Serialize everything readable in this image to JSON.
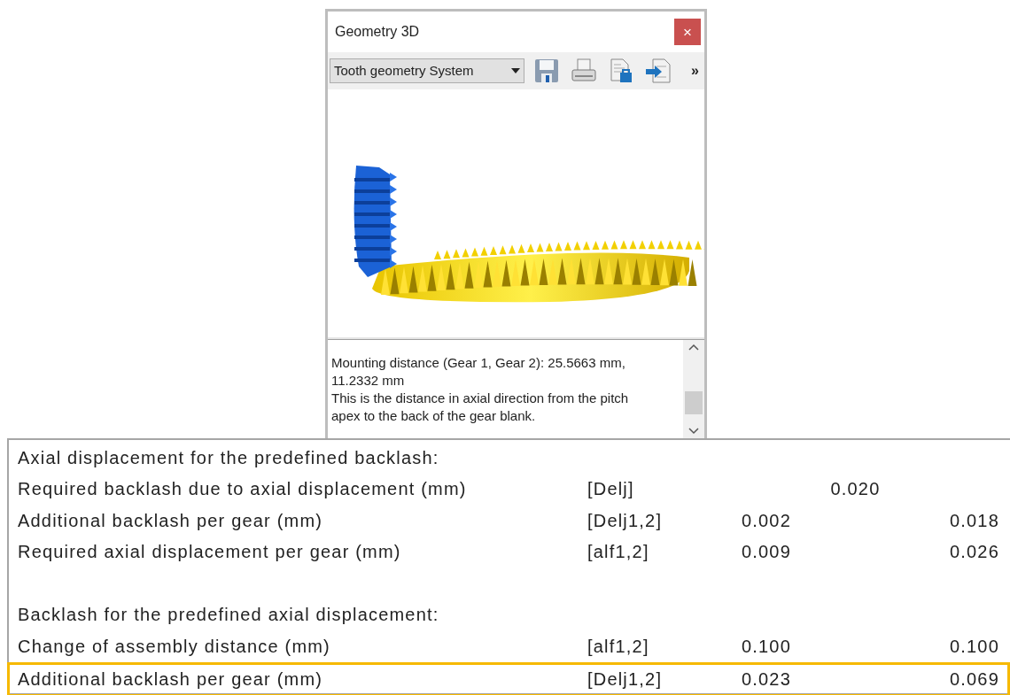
{
  "window": {
    "title": "Geometry 3D",
    "close_label": "×"
  },
  "toolbar": {
    "dropdown": {
      "value": "Tooth geometry System"
    },
    "tools": [
      {
        "kind": "save"
      },
      {
        "kind": "print"
      },
      {
        "kind": "lock"
      },
      {
        "kind": "import"
      }
    ],
    "overflow": "»"
  },
  "info": {
    "paragraphs": [
      "Mounting distance (Gear 1, Gear 2): 25.5663 mm, 11.2332 mm",
      "This is the distance in axial direction from the pitch apex to the back of the gear blank."
    ]
  },
  "table": {
    "rows": [
      {
        "kind": "heading",
        "label": "Axial displacement for the predefined backlash:",
        "highlighted": false
      },
      {
        "kind": "single",
        "label": "Required backlash due to axial displacement (mm)",
        "symbol": "[Delj]",
        "values": [
          "0.020"
        ],
        "highlighted": false
      },
      {
        "kind": "data",
        "label": "Additional backlash per gear (mm)",
        "symbol": "[Delj1,2]",
        "values": [
          "0.002",
          "0.018"
        ],
        "highlighted": false
      },
      {
        "kind": "data",
        "label": "Required axial displacement per gear (mm)",
        "symbol": "[alf1,2]",
        "values": [
          "0.009",
          "0.026"
        ],
        "highlighted": false
      },
      {
        "kind": "spacer",
        "highlighted": false
      },
      {
        "kind": "heading",
        "label": "Backlash for the predefined axial displacement:",
        "highlighted": false
      },
      {
        "kind": "data",
        "label": "Change of assembly distance (mm)",
        "symbol": "[alf1,2]",
        "values": [
          "0.100",
          "0.100"
        ],
        "highlighted": false
      },
      {
        "kind": "data",
        "label": "Additional backlash per gear (mm)",
        "symbol": "[Delj1,2]",
        "values": [
          "0.023",
          "0.069"
        ],
        "highlighted": true
      }
    ]
  }
}
